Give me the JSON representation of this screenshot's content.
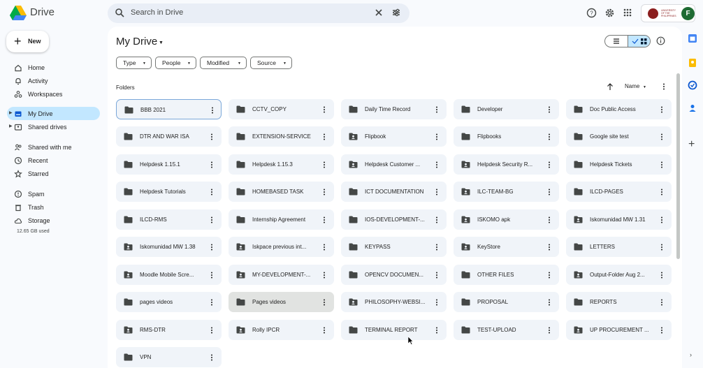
{
  "app": {
    "name": "Drive"
  },
  "search": {
    "placeholder": "Search in Drive"
  },
  "university": {
    "text": "UNIVERSITY OF THE PHILIPPINES",
    "avatar_letter": "F"
  },
  "new_button": {
    "label": "New"
  },
  "sidebar": {
    "items": [
      {
        "label": "Home",
        "icon": "home-icon"
      },
      {
        "label": "Activity",
        "icon": "bell-icon"
      },
      {
        "label": "Workspaces",
        "icon": "workspaces-icon"
      },
      {
        "label": "My Drive",
        "icon": "drive-icon",
        "active": true
      },
      {
        "label": "Shared drives",
        "icon": "shared-drives-icon"
      },
      {
        "label": "Shared with me",
        "icon": "people-icon"
      },
      {
        "label": "Recent",
        "icon": "clock-icon"
      },
      {
        "label": "Starred",
        "icon": "star-icon"
      },
      {
        "label": "Spam",
        "icon": "spam-icon"
      },
      {
        "label": "Trash",
        "icon": "trash-icon"
      },
      {
        "label": "Storage",
        "icon": "cloud-icon"
      }
    ],
    "storage_used": "12.65 GB used"
  },
  "main": {
    "title": "My Drive",
    "filters": [
      "Type",
      "People",
      "Modified",
      "Source"
    ],
    "section": "Folders",
    "sort_label": "Name",
    "folders": [
      {
        "name": "BBB 2021",
        "shared": false
      },
      {
        "name": "CCTV_COPY",
        "shared": false
      },
      {
        "name": "Daily Time Record",
        "shared": false
      },
      {
        "name": "Developer",
        "shared": false
      },
      {
        "name": "Doc Public Access",
        "shared": false
      },
      {
        "name": "DTR AND WAR ISA",
        "shared": false
      },
      {
        "name": "EXTENSION-SERVICE",
        "shared": false
      },
      {
        "name": "Flipbook",
        "shared": true
      },
      {
        "name": "Flipbooks",
        "shared": false
      },
      {
        "name": "Google site test",
        "shared": false
      },
      {
        "name": "Helpdesk 1.15.1",
        "shared": false
      },
      {
        "name": "Helpdesk 1.15.3",
        "shared": false
      },
      {
        "name": "Helpdesk Customer ...",
        "shared": true
      },
      {
        "name": "Helpdesk Security R...",
        "shared": true
      },
      {
        "name": "Helpdesk Tickets",
        "shared": false
      },
      {
        "name": "Helpdesk Tutorials",
        "shared": false
      },
      {
        "name": "HOMEBASED TASK",
        "shared": false
      },
      {
        "name": "ICT DOCUMENTATION",
        "shared": false
      },
      {
        "name": "ILC-TEAM-BG",
        "shared": true
      },
      {
        "name": "ILCD-PAGES",
        "shared": false
      },
      {
        "name": "ILCD-RMS",
        "shared": false
      },
      {
        "name": "Internship Agreement",
        "shared": false
      },
      {
        "name": "IOS-DEVELOPMENT-...",
        "shared": false
      },
      {
        "name": "ISKOMO apk",
        "shared": true
      },
      {
        "name": "Iskomunidad MW 1.31",
        "shared": true
      },
      {
        "name": "Iskomunidad MW 1.38",
        "shared": true
      },
      {
        "name": "Iskpace previous int...",
        "shared": true
      },
      {
        "name": "KEYPASS",
        "shared": false
      },
      {
        "name": "KeyStore",
        "shared": true
      },
      {
        "name": "LETTERS",
        "shared": false
      },
      {
        "name": "Moodle Mobile Scre...",
        "shared": true
      },
      {
        "name": "MY-DEVELOPMENT-...",
        "shared": true
      },
      {
        "name": "OPENCV DOCUMEN...",
        "shared": false
      },
      {
        "name": "OTHER FILES",
        "shared": false
      },
      {
        "name": "Output-Folder Aug 2...",
        "shared": true
      },
      {
        "name": "pages videos",
        "shared": false
      },
      {
        "name": "Pages videos",
        "shared": false
      },
      {
        "name": "PHILOSOPHY-WEBSI...",
        "shared": true
      },
      {
        "name": "PROPOSAL",
        "shared": false
      },
      {
        "name": "REPORTS",
        "shared": false
      },
      {
        "name": "RMS-DTR",
        "shared": true
      },
      {
        "name": "Rolly IPCR",
        "shared": true
      },
      {
        "name": "TERMINAL REPORT",
        "shared": false
      },
      {
        "name": "TEST-UPLOAD",
        "shared": false
      },
      {
        "name": "UP PROCUREMENT ...",
        "shared": true
      },
      {
        "name": "VPN",
        "shared": false
      }
    ]
  },
  "colors": {
    "accent": "#c2e7ff",
    "folder_bg": "#f0f4f9",
    "icon": "#444746"
  }
}
